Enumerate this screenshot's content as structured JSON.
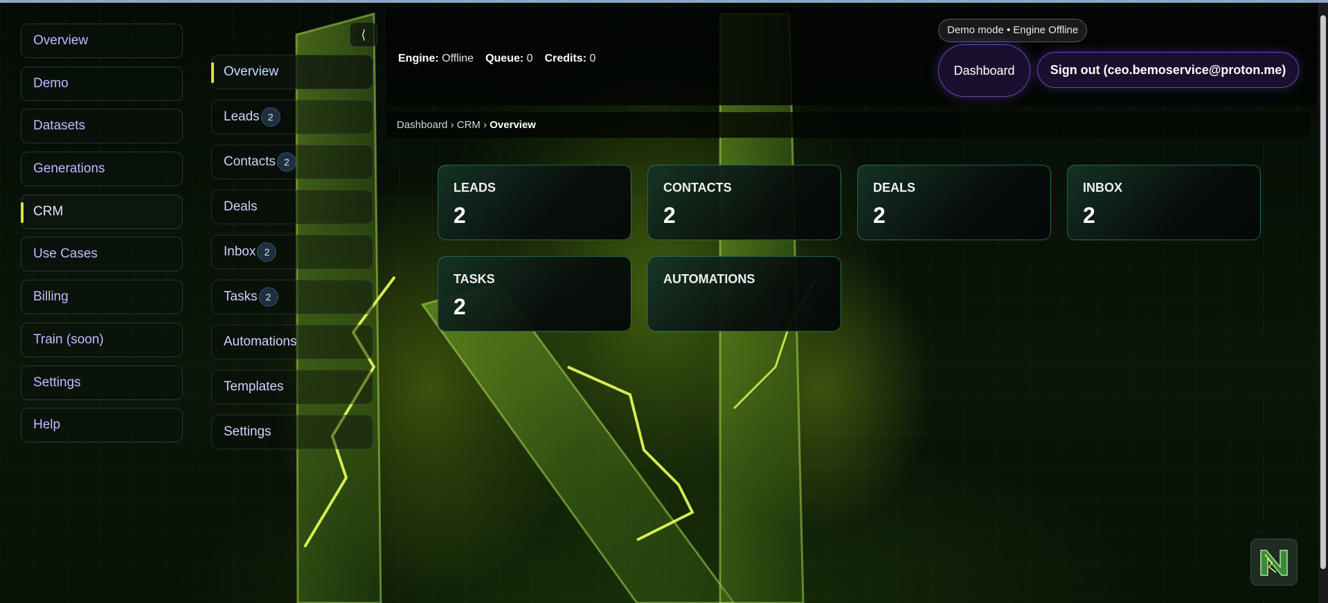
{
  "sidebar_main": {
    "items": [
      {
        "label": "Overview",
        "active": false
      },
      {
        "label": "Demo",
        "active": false
      },
      {
        "label": "Datasets",
        "active": false
      },
      {
        "label": "Generations",
        "active": false
      },
      {
        "label": "CRM",
        "active": true
      },
      {
        "label": "Use Cases",
        "active": false
      },
      {
        "label": "Billing",
        "active": false
      },
      {
        "label": "Train (soon)",
        "active": false
      },
      {
        "label": "Settings",
        "active": false
      },
      {
        "label": "Help",
        "active": false
      }
    ]
  },
  "sidebar_crm": {
    "collapse_glyph": "⟨",
    "items": [
      {
        "label": "Overview",
        "badge": "",
        "active": true
      },
      {
        "label": "Leads",
        "badge": "2",
        "active": false
      },
      {
        "label": "Contacts",
        "badge": "2",
        "active": false
      },
      {
        "label": "Deals",
        "badge": "",
        "active": false
      },
      {
        "label": "Inbox",
        "badge": "2",
        "active": false
      },
      {
        "label": "Tasks",
        "badge": "2",
        "active": false
      },
      {
        "label": "Automations",
        "badge": "",
        "active": false
      },
      {
        "label": "Templates",
        "badge": "",
        "active": false
      },
      {
        "label": "Settings",
        "badge": "",
        "active": false
      }
    ]
  },
  "status": {
    "engine_label": "Engine:",
    "engine_value": "Offline",
    "queue_label": "Queue:",
    "queue_value": "0",
    "credits_label": "Credits:",
    "credits_value": "0"
  },
  "header": {
    "demo_pill": "Demo mode • Engine Offline",
    "dashboard_button": "Dashboard",
    "signout_button": "Sign out (ceo.bemoservice@proton.me)"
  },
  "breadcrumb": {
    "items": [
      "Dashboard",
      "CRM"
    ],
    "separator": "›",
    "current": "Overview"
  },
  "stats": {
    "cards": [
      {
        "label": "LEADS",
        "value": "2"
      },
      {
        "label": "CONTACTS",
        "value": "2"
      },
      {
        "label": "DEALS",
        "value": "2"
      },
      {
        "label": "INBOX",
        "value": "2"
      },
      {
        "label": "TASKS",
        "value": "2"
      },
      {
        "label": "AUTOMATIONS",
        "value": ""
      }
    ]
  },
  "colors": {
    "accent_purple": "#6a4ab0",
    "active_indicator": "#d8e04a",
    "card_border": "#3caa78",
    "nav_text": "#c8b8ff"
  }
}
